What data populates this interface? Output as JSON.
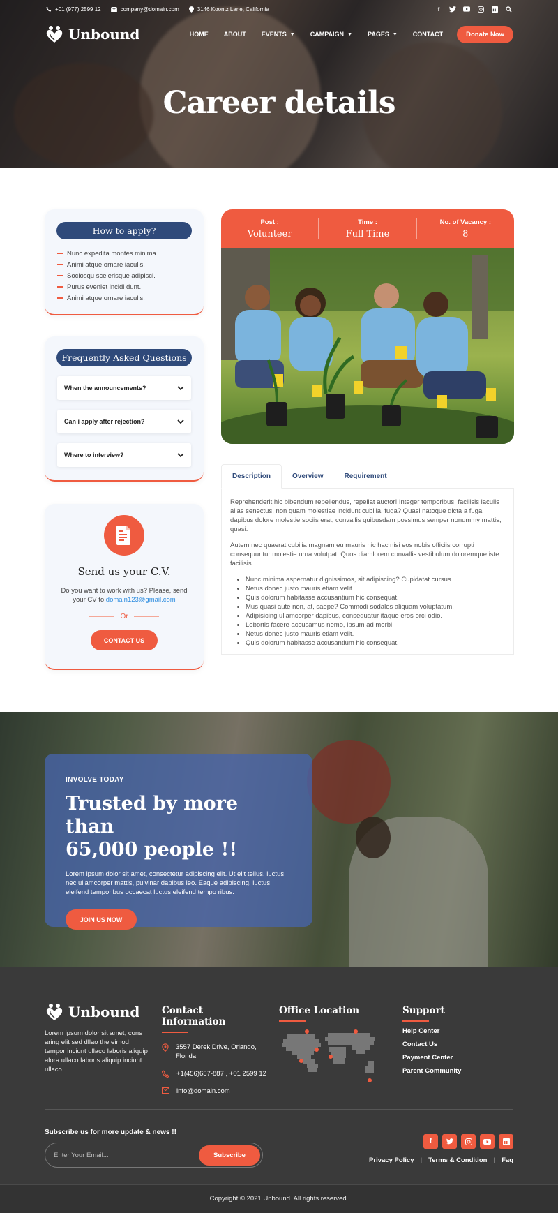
{
  "brand": {
    "name": "Unbound",
    "accent": "#ef5b40",
    "navy": "#2f4a7a"
  },
  "topbar": {
    "phone": "+01 (977) 2599 12",
    "email": "company@domain.com",
    "address": "3146 Koontz Lane, California",
    "social": [
      "facebook-icon",
      "twitter-icon",
      "youtube-icon",
      "instagram-icon",
      "linkedin-icon",
      "search-icon"
    ]
  },
  "nav": {
    "items": [
      {
        "label": "HOME"
      },
      {
        "label": "ABOUT"
      },
      {
        "label": "EVENTS",
        "dropdown": true
      },
      {
        "label": "CAMPAIGN",
        "dropdown": true
      },
      {
        "label": "PAGES",
        "dropdown": true
      },
      {
        "label": "CONTACT"
      }
    ],
    "donate": "Donate Now"
  },
  "hero": {
    "title": "Career details"
  },
  "how_to_apply": {
    "title": "How to apply?",
    "items": [
      "Nunc expedita montes minima.",
      "Animi atque ornare iaculis.",
      "Sociosqu scelerisque adipisci.",
      "Purus eveniet incidi dunt.",
      "Animi atque ornare iaculis."
    ]
  },
  "faq": {
    "title": "Frequently Asked Questions",
    "items": [
      "When the announcements?",
      "Can i apply after rejection?",
      "Where to interview?"
    ]
  },
  "cv": {
    "title": "Send us your C.V.",
    "text": "Do you want to work with us? Please, send your CV to ",
    "email": "domain123@gmail.com",
    "or": "Or",
    "button": "CONTACT US"
  },
  "job": {
    "post_label": "Post :",
    "post": "Volunteer",
    "time_label": "Time :",
    "time": "Full Time",
    "vacancy_label": "No. of Vacancy :",
    "vacancy": "8"
  },
  "tabs": [
    {
      "label": "Description",
      "active": true
    },
    {
      "label": "Overview"
    },
    {
      "label": "Requirement"
    }
  ],
  "description": {
    "p1": "Reprehenderit hic bibendum repellendus, repellat auctor! Integer temporibus, facilisis iaculis alias senectus, non quam molestiae incidunt cubilia, fuga? Quasi natoque dicta a fuga dapibus dolore molestie sociis erat, convallis quibusdam possimus semper nonummy mattis, quasi.",
    "p2": "Autem nec quaerat cubilia magnam eu mauris hic hac nisi eos nobis officiis corrupti consequuntur molestie urna volutpat! Quos diamlorem convallis vestibulum doloremque iste facilisis.",
    "bullets": [
      "Nunc minima aspernatur dignissimos, sit adipiscing? Cupidatat cursus.",
      "Netus donec justo mauris etiam velit.",
      "Quis dolorum habitasse accusantium hic consequat.",
      "Mus quasi aute non, at, saepe? Commodi sodales aliquam voluptatum.",
      "Adipisicing ullamcorper dapibus, consequatur itaque eros orci odio.",
      "Lobortis facere accusamus nemo, ipsum ad morbi.",
      "Netus donec justo mauris etiam velit.",
      "Quis dolorum habitasse accusantium hic consequat."
    ]
  },
  "trust": {
    "overline": "INVOLVE TODAY",
    "title_line1": "Trusted by more than",
    "title_line2": "65,000 people !!",
    "text": "Lorem ipsum dolor sit amet, consectetur adipiscing elit. Ut elit tellus, luctus nec ullamcorper mattis, pulvinar dapibus leo. Eaque adipiscing, luctus eleifend temporibus occaecat luctus eleifend tempo ribus.",
    "button": "JOIN US NOW"
  },
  "footer": {
    "about": "Lorem ipsum dolor sit amet, cons aring elit sed dllao the eimod tempor inciunt ullaco laboris aliquip alora ullaco laboris aliquip inciunt ullaco.",
    "contact_title": "Contact Information",
    "contact": {
      "address": "3557 Derek Drive, Orlando, Florida",
      "phone": "+1(456)657-887 , +01 2599 12",
      "email": "info@domain.com"
    },
    "office_title": "Office Location",
    "support_title": "Support",
    "support": [
      "Help Center",
      "Contact Us",
      "Payment Center",
      "Parent Community"
    ],
    "subscribe_title": "Subscribe us for more update & news !!",
    "email_placeholder": "Enter Your Email...",
    "subscribe_button": "Subscribe",
    "social": [
      "facebook-icon",
      "twitter-icon",
      "instagram-icon",
      "youtube-icon",
      "linkedin-icon"
    ],
    "links": [
      "Privacy Policy",
      "Terms & Condition",
      "Faq"
    ],
    "copyright": "Copyright © 2021 Unbound. All rights reserved."
  }
}
